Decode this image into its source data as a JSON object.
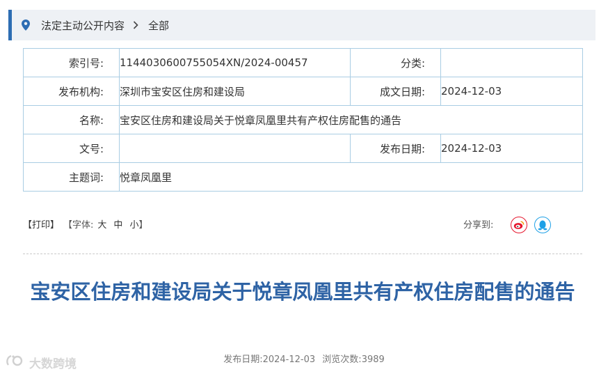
{
  "breadcrumb": {
    "items": [
      "法定主动公开内容",
      "全部"
    ]
  },
  "meta": {
    "index_label": "索引号:",
    "index_value": "1144030600755054XN/2024-00457",
    "category_label": "分类:",
    "category_value": "",
    "agency_label": "发布机构:",
    "agency_value": "深圳市宝安区住房和建设局",
    "created_label": "成文日期:",
    "created_value": "2024-12-03",
    "name_label": "名称:",
    "name_value": "宝安区住房和建设局关于悦章凤凰里共有产权住房配售的通告",
    "docno_label": "文号:",
    "docno_value": "",
    "published_label": "发布日期:",
    "published_value": "2024-12-03",
    "keywords_label": "主题词:",
    "keywords_value": "悦章凤凰里"
  },
  "toolbar": {
    "print": "【打印】",
    "font_open": "【字体:",
    "font_large": "大",
    "font_medium": "中",
    "font_small": "小",
    "font_close": "】",
    "share_label": "分享到:"
  },
  "article": {
    "title": "宝安区住房和建设局关于悦章凤凰里共有产权住房配售的通告",
    "pub_date_label": "发布日期:",
    "pub_date": "2024-12-03",
    "views_label": "浏览次数:",
    "views": "3989"
  },
  "watermark": {
    "text": "大数跨境"
  },
  "colors": {
    "accent": "#2d6db3",
    "title": "#2e63a5",
    "table_border": "#a9cde3",
    "weibo": "#e6162d",
    "qq": "#1ea0e6"
  },
  "icons": [
    "location-pin-icon",
    "chevron-right-icon",
    "weibo-icon",
    "qq-icon"
  ]
}
